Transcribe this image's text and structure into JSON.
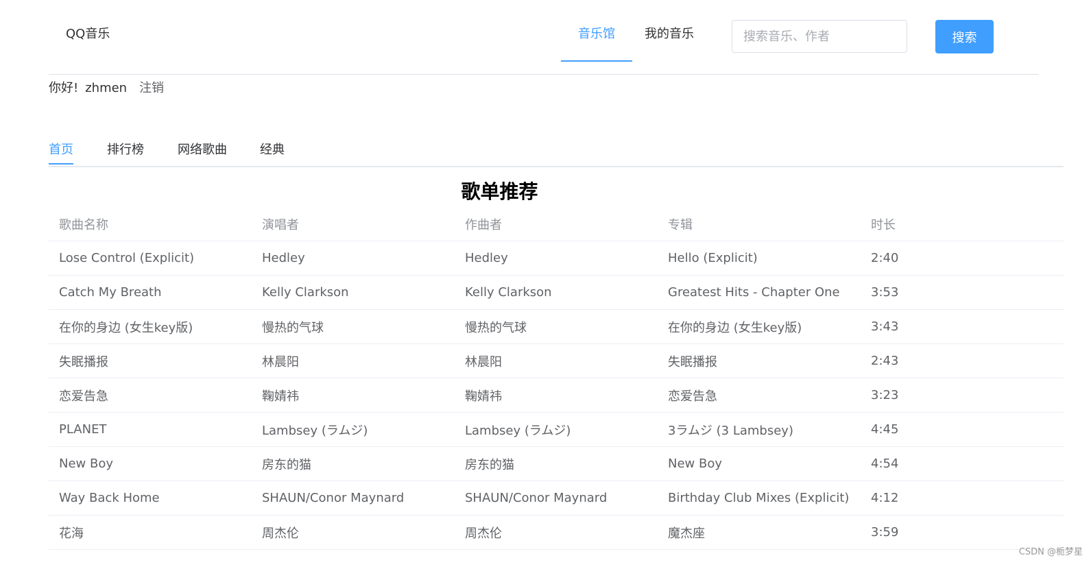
{
  "header": {
    "brand": "QQ音乐",
    "nav": [
      {
        "label": "音乐馆",
        "active": true
      },
      {
        "label": "我的音乐",
        "active": false
      }
    ],
    "search_placeholder": "搜索音乐、作者",
    "search_button": "搜索"
  },
  "user": {
    "greeting": "你好!",
    "username": "zhmen",
    "logout": "注销"
  },
  "tabs": [
    {
      "label": "首页",
      "active": true
    },
    {
      "label": "排行榜",
      "active": false
    },
    {
      "label": "网络歌曲",
      "active": false
    },
    {
      "label": "经典",
      "active": false
    }
  ],
  "section_title": "歌单推荐",
  "table": {
    "columns": [
      "歌曲名称",
      "演唱者",
      "作曲者",
      "专辑",
      "时长"
    ],
    "rows": [
      [
        "Lose Control (Explicit)",
        "Hedley",
        "Hedley",
        "Hello (Explicit)",
        "2:40"
      ],
      [
        "Catch My Breath",
        "Kelly Clarkson",
        "Kelly Clarkson",
        "Greatest Hits - Chapter One",
        "3:53"
      ],
      [
        "在你的身边 (女生key版)",
        "慢热的气球",
        "慢热的气球",
        "在你的身边 (女生key版)",
        "3:43"
      ],
      [
        "失眠播报",
        "林晨阳",
        "林晨阳",
        "失眠播报",
        "2:43"
      ],
      [
        "恋爱告急",
        "鞠婧祎",
        "鞠婧祎",
        "恋爱告急",
        "3:23"
      ],
      [
        "PLANET",
        "Lambsey (ラムジ)",
        "Lambsey (ラムジ)",
        "3ラムジ (3 Lambsey)",
        "4:45"
      ],
      [
        "New Boy",
        "房东的猫",
        "房东的猫",
        "New Boy",
        "4:54"
      ],
      [
        "Way Back Home",
        "SHAUN/Conor Maynard",
        "SHAUN/Conor Maynard",
        "Birthday Club Mixes (Explicit)",
        "4:12"
      ],
      [
        "花海",
        "周杰伦",
        "周杰伦",
        "魔杰座",
        "3:59"
      ]
    ]
  },
  "watermark": "CSDN @栀梦星",
  "colors": {
    "accent": "#409eff",
    "divider": "#dcdfe6",
    "row_border": "#ebeef5",
    "header_text": "#909399",
    "cell_text": "#606266"
  }
}
